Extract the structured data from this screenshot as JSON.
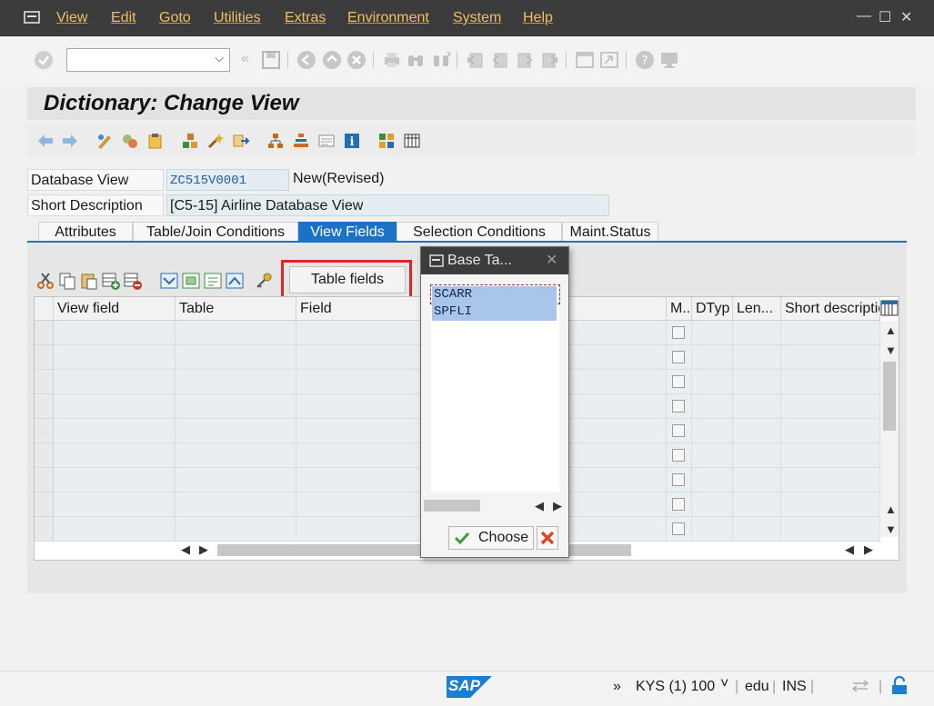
{
  "menu": {
    "items": [
      "View",
      "Edit",
      "Goto",
      "Utilities",
      "Extras",
      "Environment",
      "System",
      "Help"
    ]
  },
  "window_controls": {
    "minimize": "—",
    "maximize": "☐",
    "close": "✕"
  },
  "system_toolbar": {
    "command_field_value": "",
    "icons": [
      "enter-icon",
      "command-dropdown-icon",
      "collapse-icon",
      "save-icon",
      "back-icon",
      "exit-icon",
      "cancel-icon",
      "print-icon",
      "find-icon",
      "find-next-icon",
      "first-page-icon",
      "previous-page-icon",
      "next-page-icon",
      "last-page-icon",
      "new-session-icon",
      "shortcut-icon",
      "help-icon",
      "customize-layout-icon"
    ]
  },
  "title": "Dictionary: Change View",
  "header": {
    "database_view_label": "Database View",
    "database_view_value": "ZC515V0001",
    "status": "New(Revised)",
    "short_description_label": "Short Description",
    "short_description_value": "[C5-15] Airline Database View"
  },
  "tabs": [
    {
      "label": "Attributes",
      "active": false
    },
    {
      "label": "Table/Join Conditions",
      "active": false
    },
    {
      "label": "View Fields",
      "active": true
    },
    {
      "label": "Selection Conditions",
      "active": false
    },
    {
      "label": "Maint.Status",
      "active": false
    }
  ],
  "table_fields_button": "Table fields",
  "grid": {
    "columns": [
      "View field",
      "Table",
      "Field",
      "M..",
      "DTyp",
      "Len...",
      "Short descriptio"
    ],
    "row_count": 9
  },
  "popup": {
    "title": "Base Ta...",
    "items": [
      "SCARR",
      "SPFLI"
    ],
    "choose_label": "Choose"
  },
  "status_bar": {
    "logo": "SAP",
    "arrows": "»",
    "system": "KYS (1) 100",
    "dropdown": "˅",
    "separator": "|",
    "client": "edu",
    "mode": "INS"
  },
  "colors": {
    "menu_text": "#f0c060",
    "accent_blue": "#1a73c6",
    "highlight_red": "#e02424"
  }
}
